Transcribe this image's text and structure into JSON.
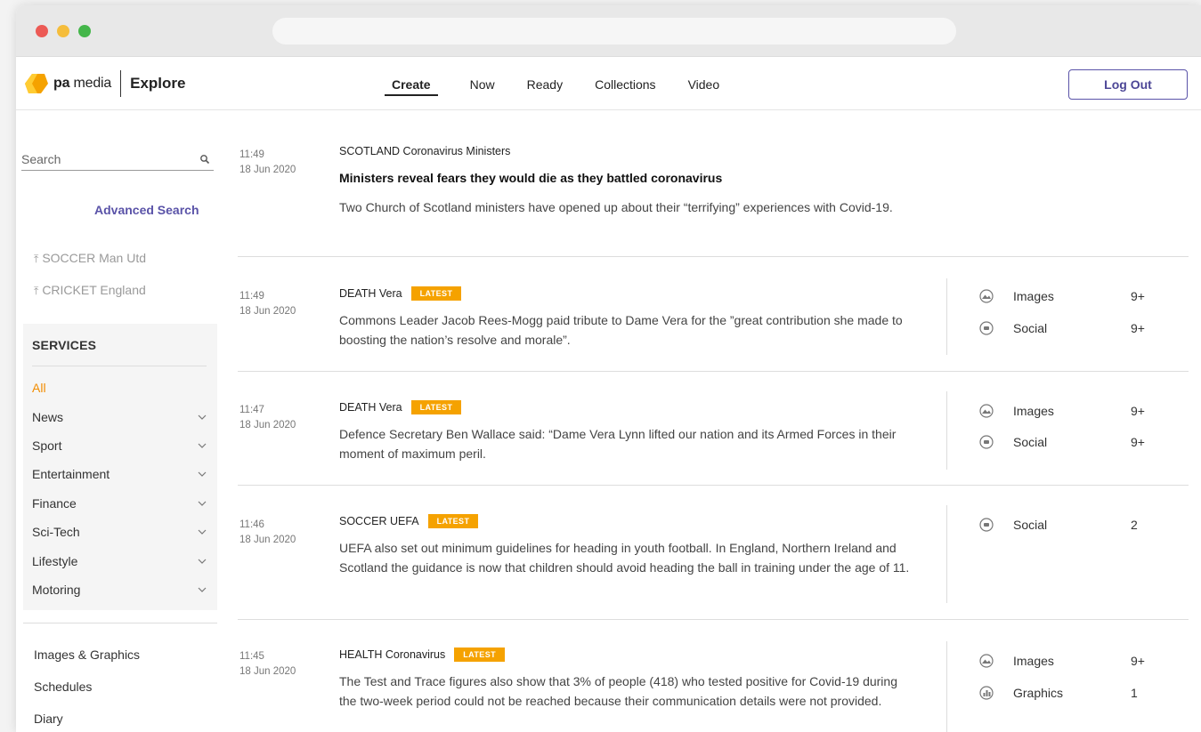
{
  "brand": {
    "name_bold": "pa",
    "name_rest": " media",
    "product": "Explore"
  },
  "nav": {
    "tabs": [
      {
        "label": "Create",
        "active": true
      },
      {
        "label": "Now"
      },
      {
        "label": "Ready"
      },
      {
        "label": "Collections"
      },
      {
        "label": "Video"
      }
    ],
    "logout_label": "Log Out"
  },
  "sidebar": {
    "search_placeholder": "Search",
    "advanced_search": "Advanced Search",
    "pinned": [
      "SOCCER Man Utd",
      "CRICKET England"
    ],
    "services_title": "SERVICES",
    "services": [
      {
        "label": "All",
        "selected": true
      },
      {
        "label": "News"
      },
      {
        "label": "Sport"
      },
      {
        "label": "Entertainment"
      },
      {
        "label": "Finance"
      },
      {
        "label": "Sci-Tech"
      },
      {
        "label": "Lifestyle"
      },
      {
        "label": "Motoring"
      }
    ],
    "extras": [
      "Images & Graphics",
      "Schedules",
      "Diary"
    ]
  },
  "feed": [
    {
      "time": "11:49",
      "date": "18 Jun 2020",
      "slug": "SCOTLAND Coronavirus Ministers",
      "headline": "Ministers reveal fears they would die as they battled coronavirus",
      "summary": "Two Church of Scotland ministers have opened up about their “terrifying” experiences with Covid-19."
    },
    {
      "time": "11:49",
      "date": "18 Jun 2020",
      "slug": "DEATH Vera",
      "badge": "LATEST",
      "summary": "Commons Leader Jacob Rees-Mogg paid tribute to Dame Vera for the ”great contribution she made to boosting the nation’s resolve and morale”.",
      "assets": [
        {
          "icon": "images-icon",
          "label": "Images",
          "count": "9+"
        },
        {
          "icon": "social-icon",
          "label": "Social",
          "count": "9+"
        }
      ]
    },
    {
      "time": "11:47",
      "date": "18 Jun 2020",
      "slug": "DEATH Vera",
      "badge": "LATEST",
      "summary": "Defence Secretary Ben Wallace said: “Dame Vera Lynn lifted our nation and its Armed Forces in their moment of maximum peril.",
      "assets": [
        {
          "icon": "images-icon",
          "label": "Images",
          "count": "9+"
        },
        {
          "icon": "social-icon",
          "label": "Social",
          "count": "9+"
        }
      ]
    },
    {
      "time": "11:46",
      "date": "18 Jun 2020",
      "slug": "SOCCER UEFA",
      "badge": "LATEST",
      "summary": "UEFA also set out minimum guidelines for heading in youth football. In England, Northern Ireland and Scotland the guidance is now that children should avoid heading the ball in training under the age of 11.",
      "assets": [
        {
          "icon": "social-icon",
          "label": "Social",
          "count": "2"
        }
      ]
    },
    {
      "time": "11:45",
      "date": "18 Jun 2020",
      "slug": "HEALTH Coronavirus",
      "badge": "LATEST",
      "summary": "The Test and Trace figures also show that 3% of people (418) who tested positive for Covid-19 during the two-week period could not be reached because their communication details were not provided.",
      "assets": [
        {
          "icon": "images-icon",
          "label": "Images",
          "count": "9+"
        },
        {
          "icon": "graphics-icon",
          "label": "Graphics",
          "count": "1"
        }
      ]
    }
  ],
  "colors": {
    "accent": "#5a53a8",
    "badge": "#f5a200",
    "selected_service": "#f28c00"
  }
}
